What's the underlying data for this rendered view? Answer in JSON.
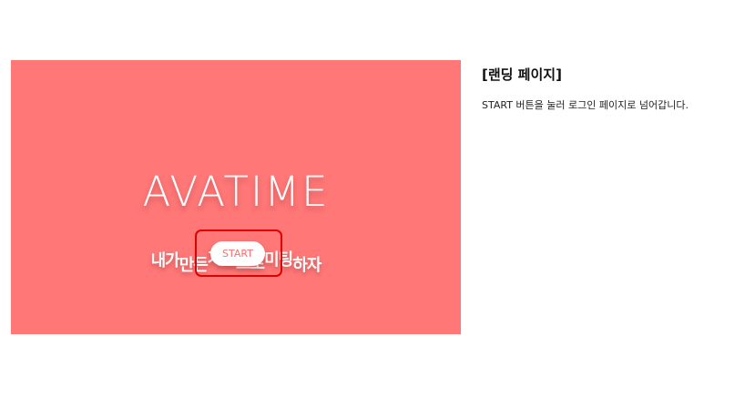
{
  "preview": {
    "logo": "AVATIME",
    "tagline_parts": [
      "내가",
      "만든",
      "가면",
      "으로",
      "미팅",
      "하자"
    ],
    "start_label": "START",
    "background": "#ff7777",
    "button_text_color": "#ff6b6b",
    "highlight_color": "#e00000"
  },
  "description": {
    "title": "[랜딩 페이지]",
    "text": "START 버튼을 눌러 로그인 페이지로 넘어갑니다."
  }
}
